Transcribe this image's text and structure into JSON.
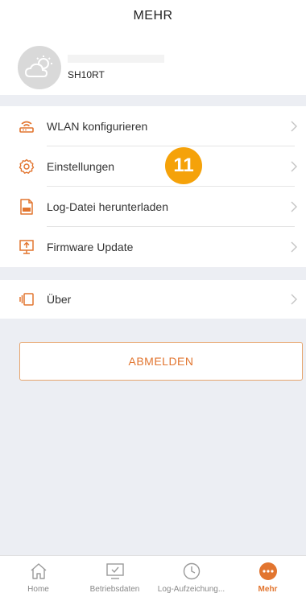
{
  "header": {
    "title": "MEHR"
  },
  "profile": {
    "device_name": "SH10RT"
  },
  "menu": {
    "items": [
      {
        "label": "WLAN konfigurieren"
      },
      {
        "label": "Einstellungen"
      },
      {
        "label": "Log-Datei herunterladen"
      },
      {
        "label": "Firmware Update"
      }
    ],
    "about": {
      "label": "Über"
    }
  },
  "badge": {
    "text": "11"
  },
  "logout": {
    "label": "ABMELDEN"
  },
  "tabbar": {
    "tabs": [
      {
        "label": "Home"
      },
      {
        "label": "Betriebsdaten"
      },
      {
        "label": "Log-Aufzeichung..."
      },
      {
        "label": "Mehr"
      }
    ]
  },
  "colors": {
    "accent": "#e2752f",
    "badge": "#f5a20a",
    "background": "#eceef3"
  }
}
